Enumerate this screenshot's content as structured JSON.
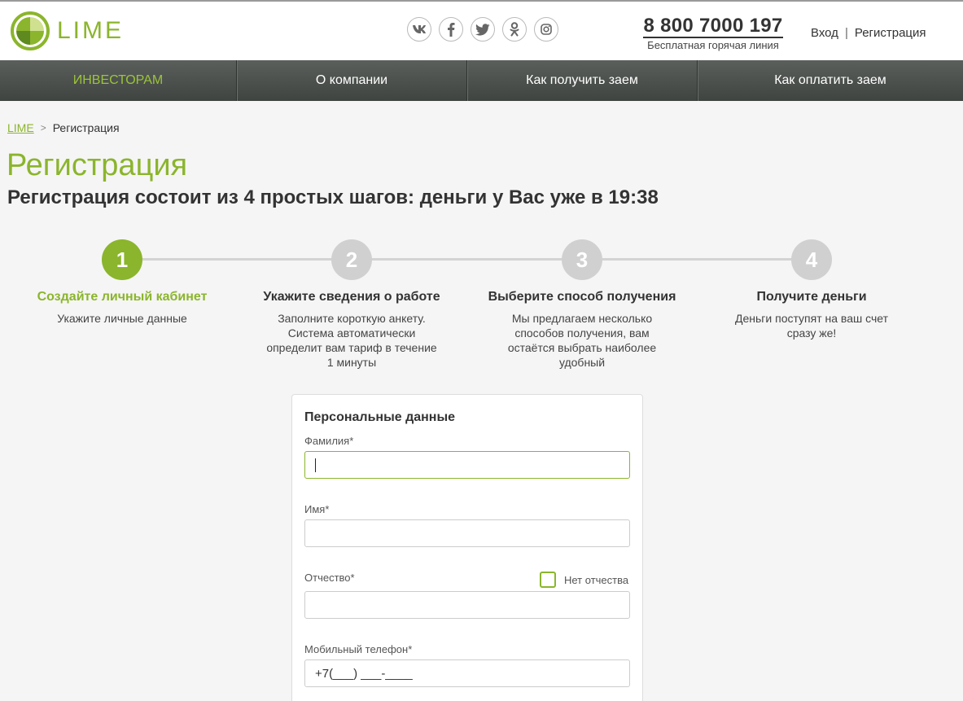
{
  "header": {
    "logo_text": "LIME",
    "socials": [
      {
        "name": "vk-icon",
        "glyph": "vk"
      },
      {
        "name": "facebook-icon",
        "glyph": "f"
      },
      {
        "name": "twitter-icon",
        "glyph": "t"
      },
      {
        "name": "odnoklassniki-icon",
        "glyph": "ok"
      },
      {
        "name": "instagram-icon",
        "glyph": "ig"
      }
    ],
    "hotline_number": "8 800 7000 197",
    "hotline_caption": "Бесплатная горячая линия",
    "login": "Вход",
    "auth_separator": "|",
    "register": "Регистрация"
  },
  "nav": {
    "items": [
      "ИНВЕСТОРАМ",
      "О компании",
      "Как получить заем",
      "Как оплатить заем"
    ]
  },
  "breadcrumb": {
    "home": "LIME",
    "separator": ">",
    "current": "Регистрация"
  },
  "page": {
    "title": "Регистрация",
    "subtitle": "Регистрация состоит из 4 простых шагов: деньги у Вас уже в 19:38"
  },
  "steps": [
    {
      "number": "1",
      "title": "Создайте личный кабинет",
      "desc": "Укажите личные данные",
      "active": true
    },
    {
      "number": "2",
      "title": "Укажите сведения о работе",
      "desc": "Заполните короткую анкету. Система автоматически определит вам тариф в течение 1 минуты",
      "active": false
    },
    {
      "number": "3",
      "title": "Выберите способ получения",
      "desc": "Мы предлагаем несколько способов получения, вам остаётся выбрать наиболее удобный",
      "active": false
    },
    {
      "number": "4",
      "title": "Получите деньги",
      "desc": "Деньги поступят на ваш счет сразу же!",
      "active": false
    }
  ],
  "form": {
    "title": "Персональные данные",
    "last_name_label": "Фамилия*",
    "last_name_value": "",
    "first_name_label": "Имя*",
    "first_name_value": "",
    "middle_name_label": "Отчество*",
    "middle_name_value": "",
    "no_middle_name_label": "Нет отчества",
    "phone_label": "Мобильный телефон*",
    "phone_value": "+7(___) ___-____"
  },
  "colors": {
    "accent": "#8bb52c",
    "nav_bg": "#4a4f4b",
    "inactive_step": "#d0d0d0"
  }
}
